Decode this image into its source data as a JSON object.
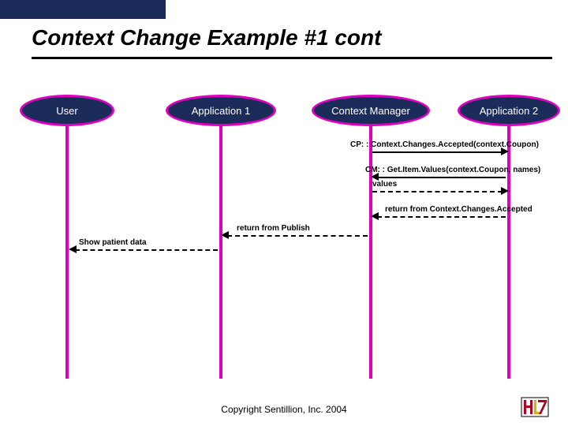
{
  "title": "Context Change Example #1 cont",
  "actors": {
    "user": "User",
    "app1": "Application 1",
    "cm": "Context Manager",
    "app2": "Application 2"
  },
  "messages": {
    "m1": "CP: : Context.Changes.Accepted(context.Coupon)",
    "m2": "CM: : Get.Item.Values(context.Coupon, names)",
    "m3": "values",
    "m4": "return from Context.Changes.Accepted",
    "m5": "return from Publish",
    "m6": "Show patient data"
  },
  "footer": {
    "copyright": "Copyright Sentillion, Inc. 2004"
  },
  "logo": {
    "name": "HL7"
  },
  "chart_data": {
    "type": "table",
    "description": "UML sequence diagram",
    "lifelines": [
      "User",
      "Application 1",
      "Context Manager",
      "Application 2"
    ],
    "interactions": [
      {
        "from": "Context Manager",
        "to": "Application 2",
        "label": "CP: : Context.Changes.Accepted(context.Coupon)",
        "style": "solid"
      },
      {
        "from": "Application 2",
        "to": "Context Manager",
        "label": "CM: : Get.Item.Values(context.Coupon, names)",
        "style": "solid"
      },
      {
        "from": "Context Manager",
        "to": "Application 2",
        "label": "values",
        "style": "dashed"
      },
      {
        "from": "Application 2",
        "to": "Context Manager",
        "label": "return from Context.Changes.Accepted",
        "style": "dashed"
      },
      {
        "from": "Context Manager",
        "to": "Application 1",
        "label": "return from Publish",
        "style": "dashed"
      },
      {
        "from": "Application 1",
        "to": "User",
        "label": "Show patient data",
        "style": "dashed"
      }
    ]
  }
}
